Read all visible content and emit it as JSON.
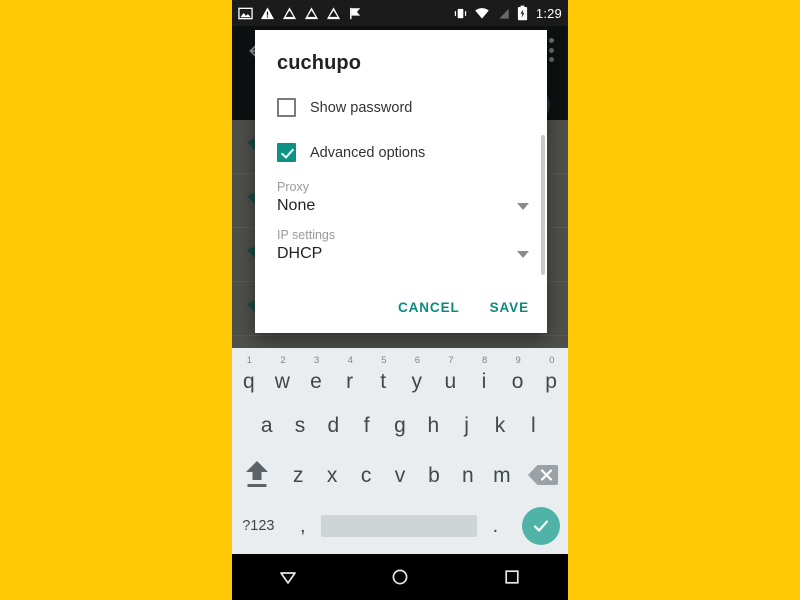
{
  "statusbar": {
    "time": "1:29",
    "left_icons": [
      "image-icon",
      "warning-triangle-icon",
      "upload-triangle-icon",
      "upload-triangle-icon",
      "upload-triangle-icon",
      "flag-icon"
    ],
    "right_icons": [
      "vibrate-icon",
      "wifi-icon",
      "signal-off-icon",
      "battery-charging-icon"
    ]
  },
  "background": {
    "screen": "wifi-settings",
    "network_rows": 4,
    "accent": "#1f6b63"
  },
  "dialog": {
    "title": "cuchupo",
    "show_password": {
      "label": "Show password",
      "checked": false
    },
    "advanced_options": {
      "label": "Advanced options",
      "checked": true
    },
    "proxy": {
      "label": "Proxy",
      "value": "None"
    },
    "ip_settings": {
      "label": "IP settings",
      "value": "DHCP"
    },
    "cancel_label": "CANCEL",
    "save_label": "SAVE",
    "accent": "#0d8a80"
  },
  "keyboard": {
    "row1": [
      {
        "key": "q",
        "num": "1"
      },
      {
        "key": "w",
        "num": "2"
      },
      {
        "key": "e",
        "num": "3"
      },
      {
        "key": "r",
        "num": "4"
      },
      {
        "key": "t",
        "num": "5"
      },
      {
        "key": "y",
        "num": "6"
      },
      {
        "key": "u",
        "num": "7"
      },
      {
        "key": "i",
        "num": "8"
      },
      {
        "key": "o",
        "num": "9"
      },
      {
        "key": "p",
        "num": "0"
      }
    ],
    "row2": [
      "a",
      "s",
      "d",
      "f",
      "g",
      "h",
      "j",
      "k",
      "l"
    ],
    "row3_letters": [
      "z",
      "x",
      "c",
      "v",
      "b",
      "n",
      "m"
    ],
    "shift_key": "shift-icon",
    "backspace_key": "backspace-icon",
    "row4": {
      "symbols_label": "?123",
      "comma": ",",
      "space": "",
      "period": ".",
      "enter": "check-icon"
    },
    "enter_color": "#4fb3a8"
  },
  "navbar": {
    "back": "back-triangle-icon",
    "home": "home-circle-icon",
    "recents": "recents-square-icon"
  }
}
